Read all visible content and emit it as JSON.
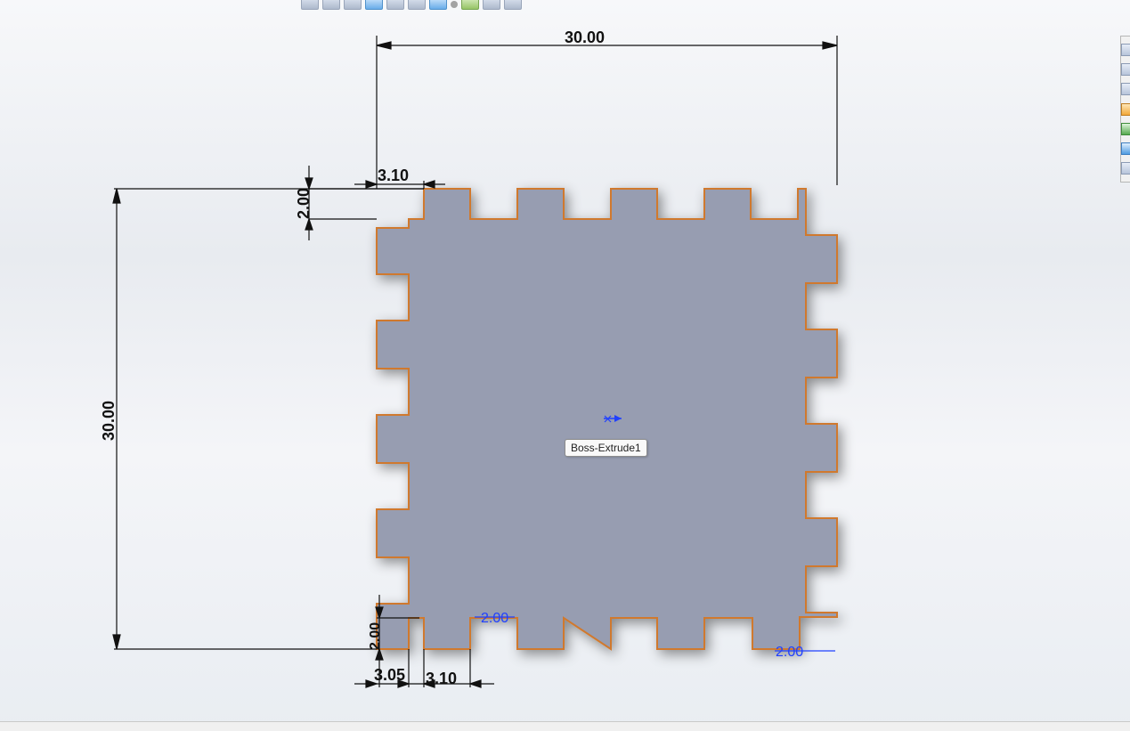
{
  "tooltip": {
    "label": "Boss-Extrude1"
  },
  "dimensions": {
    "overall_width": "30.00",
    "overall_height": "30.00",
    "top_tab_width": "3.10",
    "top_tab_height": "2.00",
    "bottom_left_height": "2.00",
    "bottom_left_width": "3.05",
    "bottom_tab_width": "3.10",
    "blue_dim_left": "2.00",
    "blue_dim_right": "2.00"
  },
  "icons": {
    "view_tools": [
      "zoom-icon",
      "zoom-to-fit-icon",
      "pan-icon",
      "section-view-icon",
      "measure-icon",
      "display-style-icon",
      "view-orientation-icon",
      "lighting-icon",
      "appearance-icon",
      "scene-icon",
      "settings-icon"
    ],
    "sidebar_tools": [
      "home-icon",
      "zoom-area-icon",
      "sketch-icon",
      "relations-icon",
      "display-icon",
      "table-icon",
      "search-icon"
    ]
  },
  "colors": {
    "part_fill": "#979db1",
    "part_edge": "#d0792e",
    "dimension_line": "#111111",
    "dimension_blue": "#2040ff"
  }
}
